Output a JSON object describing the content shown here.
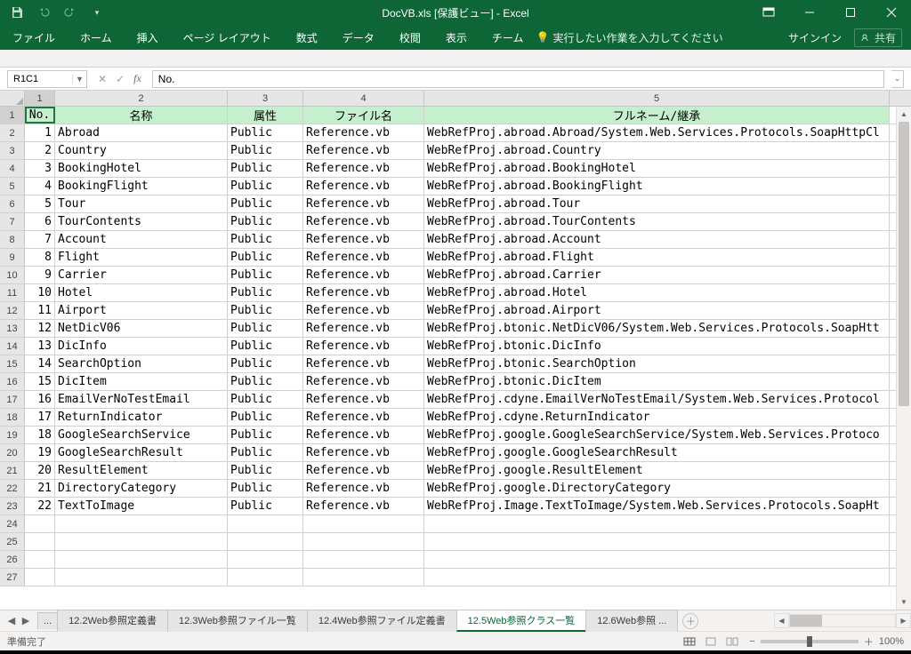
{
  "titlebar": {
    "title": "DocVB.xls  [保護ビュー] - Excel"
  },
  "ribbon": {
    "tabs": [
      "ファイル",
      "ホーム",
      "挿入",
      "ページ レイアウト",
      "数式",
      "データ",
      "校閲",
      "表示",
      "チーム"
    ],
    "tell_placeholder": "実行したい作業を入力してください",
    "signin": "サインイン",
    "share": "共有"
  },
  "namebox": "R1C1",
  "formula": "No.",
  "columns": {
    "headers": [
      "1",
      "2",
      "3",
      "4",
      "5"
    ],
    "selected": 0
  },
  "header_row": {
    "label": "1",
    "cells": [
      "No.",
      "名称",
      "属性",
      "ファイル名",
      "フルネーム/継承"
    ]
  },
  "rows": [
    {
      "rn": "2",
      "no": "1",
      "name": "Abroad",
      "attr": "Public",
      "file": "Reference.vb",
      "full": "WebRefProj.abroad.Abroad/System.Web.Services.Protocols.SoapHttpCl"
    },
    {
      "rn": "3",
      "no": "2",
      "name": "Country",
      "attr": "Public",
      "file": "Reference.vb",
      "full": "WebRefProj.abroad.Country"
    },
    {
      "rn": "4",
      "no": "3",
      "name": "BookingHotel",
      "attr": "Public",
      "file": "Reference.vb",
      "full": "WebRefProj.abroad.BookingHotel"
    },
    {
      "rn": "5",
      "no": "4",
      "name": "BookingFlight",
      "attr": "Public",
      "file": "Reference.vb",
      "full": "WebRefProj.abroad.BookingFlight"
    },
    {
      "rn": "6",
      "no": "5",
      "name": "Tour",
      "attr": "Public",
      "file": "Reference.vb",
      "full": "WebRefProj.abroad.Tour"
    },
    {
      "rn": "7",
      "no": "6",
      "name": "TourContents",
      "attr": "Public",
      "file": "Reference.vb",
      "full": "WebRefProj.abroad.TourContents"
    },
    {
      "rn": "8",
      "no": "7",
      "name": "Account",
      "attr": "Public",
      "file": "Reference.vb",
      "full": "WebRefProj.abroad.Account"
    },
    {
      "rn": "9",
      "no": "8",
      "name": "Flight",
      "attr": "Public",
      "file": "Reference.vb",
      "full": "WebRefProj.abroad.Flight"
    },
    {
      "rn": "10",
      "no": "9",
      "name": "Carrier",
      "attr": "Public",
      "file": "Reference.vb",
      "full": "WebRefProj.abroad.Carrier"
    },
    {
      "rn": "11",
      "no": "10",
      "name": "Hotel",
      "attr": "Public",
      "file": "Reference.vb",
      "full": "WebRefProj.abroad.Hotel"
    },
    {
      "rn": "12",
      "no": "11",
      "name": "Airport",
      "attr": "Public",
      "file": "Reference.vb",
      "full": "WebRefProj.abroad.Airport"
    },
    {
      "rn": "13",
      "no": "12",
      "name": "NetDicV06",
      "attr": "Public",
      "file": "Reference.vb",
      "full": "WebRefProj.btonic.NetDicV06/System.Web.Services.Protocols.SoapHtt"
    },
    {
      "rn": "14",
      "no": "13",
      "name": "DicInfo",
      "attr": "Public",
      "file": "Reference.vb",
      "full": "WebRefProj.btonic.DicInfo"
    },
    {
      "rn": "15",
      "no": "14",
      "name": "SearchOption",
      "attr": "Public",
      "file": "Reference.vb",
      "full": "WebRefProj.btonic.SearchOption"
    },
    {
      "rn": "16",
      "no": "15",
      "name": "DicItem",
      "attr": "Public",
      "file": "Reference.vb",
      "full": "WebRefProj.btonic.DicItem"
    },
    {
      "rn": "17",
      "no": "16",
      "name": "EmailVerNoTestEmail",
      "attr": "Public",
      "file": "Reference.vb",
      "full": "WebRefProj.cdyne.EmailVerNoTestEmail/System.Web.Services.Protocol"
    },
    {
      "rn": "18",
      "no": "17",
      "name": "ReturnIndicator",
      "attr": "Public",
      "file": "Reference.vb",
      "full": "WebRefProj.cdyne.ReturnIndicator"
    },
    {
      "rn": "19",
      "no": "18",
      "name": "GoogleSearchService",
      "attr": "Public",
      "file": "Reference.vb",
      "full": "WebRefProj.google.GoogleSearchService/System.Web.Services.Protoco"
    },
    {
      "rn": "20",
      "no": "19",
      "name": "GoogleSearchResult",
      "attr": "Public",
      "file": "Reference.vb",
      "full": "WebRefProj.google.GoogleSearchResult"
    },
    {
      "rn": "21",
      "no": "20",
      "name": "ResultElement",
      "attr": "Public",
      "file": "Reference.vb",
      "full": "WebRefProj.google.ResultElement"
    },
    {
      "rn": "22",
      "no": "21",
      "name": "DirectoryCategory",
      "attr": "Public",
      "file": "Reference.vb",
      "full": "WebRefProj.google.DirectoryCategory"
    },
    {
      "rn": "23",
      "no": "22",
      "name": "TextToImage",
      "attr": "Public",
      "file": "Reference.vb",
      "full": "WebRefProj.Image.TextToImage/System.Web.Services.Protocols.SoapHt"
    }
  ],
  "empty_rows": [
    "24",
    "25",
    "26",
    "27"
  ],
  "sheet_tabs": {
    "prefix": "...",
    "tabs": [
      {
        "label": "12.2Web参照定義書"
      },
      {
        "label": "12.3Web参照ファイル一覧"
      },
      {
        "label": "12.4Web参照ファイル定義書"
      },
      {
        "label": "12.5Web参照クラス一覧",
        "active": true
      },
      {
        "label": "12.6Web参照 ..."
      }
    ]
  },
  "status": {
    "ready": "準備完了",
    "zoom": "100%"
  }
}
